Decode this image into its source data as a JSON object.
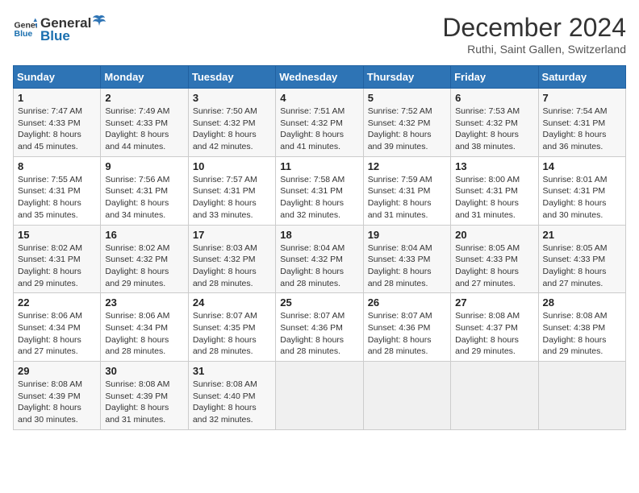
{
  "header": {
    "logo_line1": "General",
    "logo_line2": "Blue",
    "title": "December 2024",
    "subtitle": "Ruthi, Saint Gallen, Switzerland"
  },
  "days_of_week": [
    "Sunday",
    "Monday",
    "Tuesday",
    "Wednesday",
    "Thursday",
    "Friday",
    "Saturday"
  ],
  "weeks": [
    [
      {
        "day": 1,
        "info": "Sunrise: 7:47 AM\nSunset: 4:33 PM\nDaylight: 8 hours\nand 45 minutes."
      },
      {
        "day": 2,
        "info": "Sunrise: 7:49 AM\nSunset: 4:33 PM\nDaylight: 8 hours\nand 44 minutes."
      },
      {
        "day": 3,
        "info": "Sunrise: 7:50 AM\nSunset: 4:32 PM\nDaylight: 8 hours\nand 42 minutes."
      },
      {
        "day": 4,
        "info": "Sunrise: 7:51 AM\nSunset: 4:32 PM\nDaylight: 8 hours\nand 41 minutes."
      },
      {
        "day": 5,
        "info": "Sunrise: 7:52 AM\nSunset: 4:32 PM\nDaylight: 8 hours\nand 39 minutes."
      },
      {
        "day": 6,
        "info": "Sunrise: 7:53 AM\nSunset: 4:32 PM\nDaylight: 8 hours\nand 38 minutes."
      },
      {
        "day": 7,
        "info": "Sunrise: 7:54 AM\nSunset: 4:31 PM\nDaylight: 8 hours\nand 36 minutes."
      }
    ],
    [
      {
        "day": 8,
        "info": "Sunrise: 7:55 AM\nSunset: 4:31 PM\nDaylight: 8 hours\nand 35 minutes."
      },
      {
        "day": 9,
        "info": "Sunrise: 7:56 AM\nSunset: 4:31 PM\nDaylight: 8 hours\nand 34 minutes."
      },
      {
        "day": 10,
        "info": "Sunrise: 7:57 AM\nSunset: 4:31 PM\nDaylight: 8 hours\nand 33 minutes."
      },
      {
        "day": 11,
        "info": "Sunrise: 7:58 AM\nSunset: 4:31 PM\nDaylight: 8 hours\nand 32 minutes."
      },
      {
        "day": 12,
        "info": "Sunrise: 7:59 AM\nSunset: 4:31 PM\nDaylight: 8 hours\nand 31 minutes."
      },
      {
        "day": 13,
        "info": "Sunrise: 8:00 AM\nSunset: 4:31 PM\nDaylight: 8 hours\nand 31 minutes."
      },
      {
        "day": 14,
        "info": "Sunrise: 8:01 AM\nSunset: 4:31 PM\nDaylight: 8 hours\nand 30 minutes."
      }
    ],
    [
      {
        "day": 15,
        "info": "Sunrise: 8:02 AM\nSunset: 4:31 PM\nDaylight: 8 hours\nand 29 minutes."
      },
      {
        "day": 16,
        "info": "Sunrise: 8:02 AM\nSunset: 4:32 PM\nDaylight: 8 hours\nand 29 minutes."
      },
      {
        "day": 17,
        "info": "Sunrise: 8:03 AM\nSunset: 4:32 PM\nDaylight: 8 hours\nand 28 minutes."
      },
      {
        "day": 18,
        "info": "Sunrise: 8:04 AM\nSunset: 4:32 PM\nDaylight: 8 hours\nand 28 minutes."
      },
      {
        "day": 19,
        "info": "Sunrise: 8:04 AM\nSunset: 4:33 PM\nDaylight: 8 hours\nand 28 minutes."
      },
      {
        "day": 20,
        "info": "Sunrise: 8:05 AM\nSunset: 4:33 PM\nDaylight: 8 hours\nand 27 minutes."
      },
      {
        "day": 21,
        "info": "Sunrise: 8:05 AM\nSunset: 4:33 PM\nDaylight: 8 hours\nand 27 minutes."
      }
    ],
    [
      {
        "day": 22,
        "info": "Sunrise: 8:06 AM\nSunset: 4:34 PM\nDaylight: 8 hours\nand 27 minutes."
      },
      {
        "day": 23,
        "info": "Sunrise: 8:06 AM\nSunset: 4:34 PM\nDaylight: 8 hours\nand 28 minutes."
      },
      {
        "day": 24,
        "info": "Sunrise: 8:07 AM\nSunset: 4:35 PM\nDaylight: 8 hours\nand 28 minutes."
      },
      {
        "day": 25,
        "info": "Sunrise: 8:07 AM\nSunset: 4:36 PM\nDaylight: 8 hours\nand 28 minutes."
      },
      {
        "day": 26,
        "info": "Sunrise: 8:07 AM\nSunset: 4:36 PM\nDaylight: 8 hours\nand 28 minutes."
      },
      {
        "day": 27,
        "info": "Sunrise: 8:08 AM\nSunset: 4:37 PM\nDaylight: 8 hours\nand 29 minutes."
      },
      {
        "day": 28,
        "info": "Sunrise: 8:08 AM\nSunset: 4:38 PM\nDaylight: 8 hours\nand 29 minutes."
      }
    ],
    [
      {
        "day": 29,
        "info": "Sunrise: 8:08 AM\nSunset: 4:39 PM\nDaylight: 8 hours\nand 30 minutes."
      },
      {
        "day": 30,
        "info": "Sunrise: 8:08 AM\nSunset: 4:39 PM\nDaylight: 8 hours\nand 31 minutes."
      },
      {
        "day": 31,
        "info": "Sunrise: 8:08 AM\nSunset: 4:40 PM\nDaylight: 8 hours\nand 32 minutes."
      },
      null,
      null,
      null,
      null
    ]
  ]
}
